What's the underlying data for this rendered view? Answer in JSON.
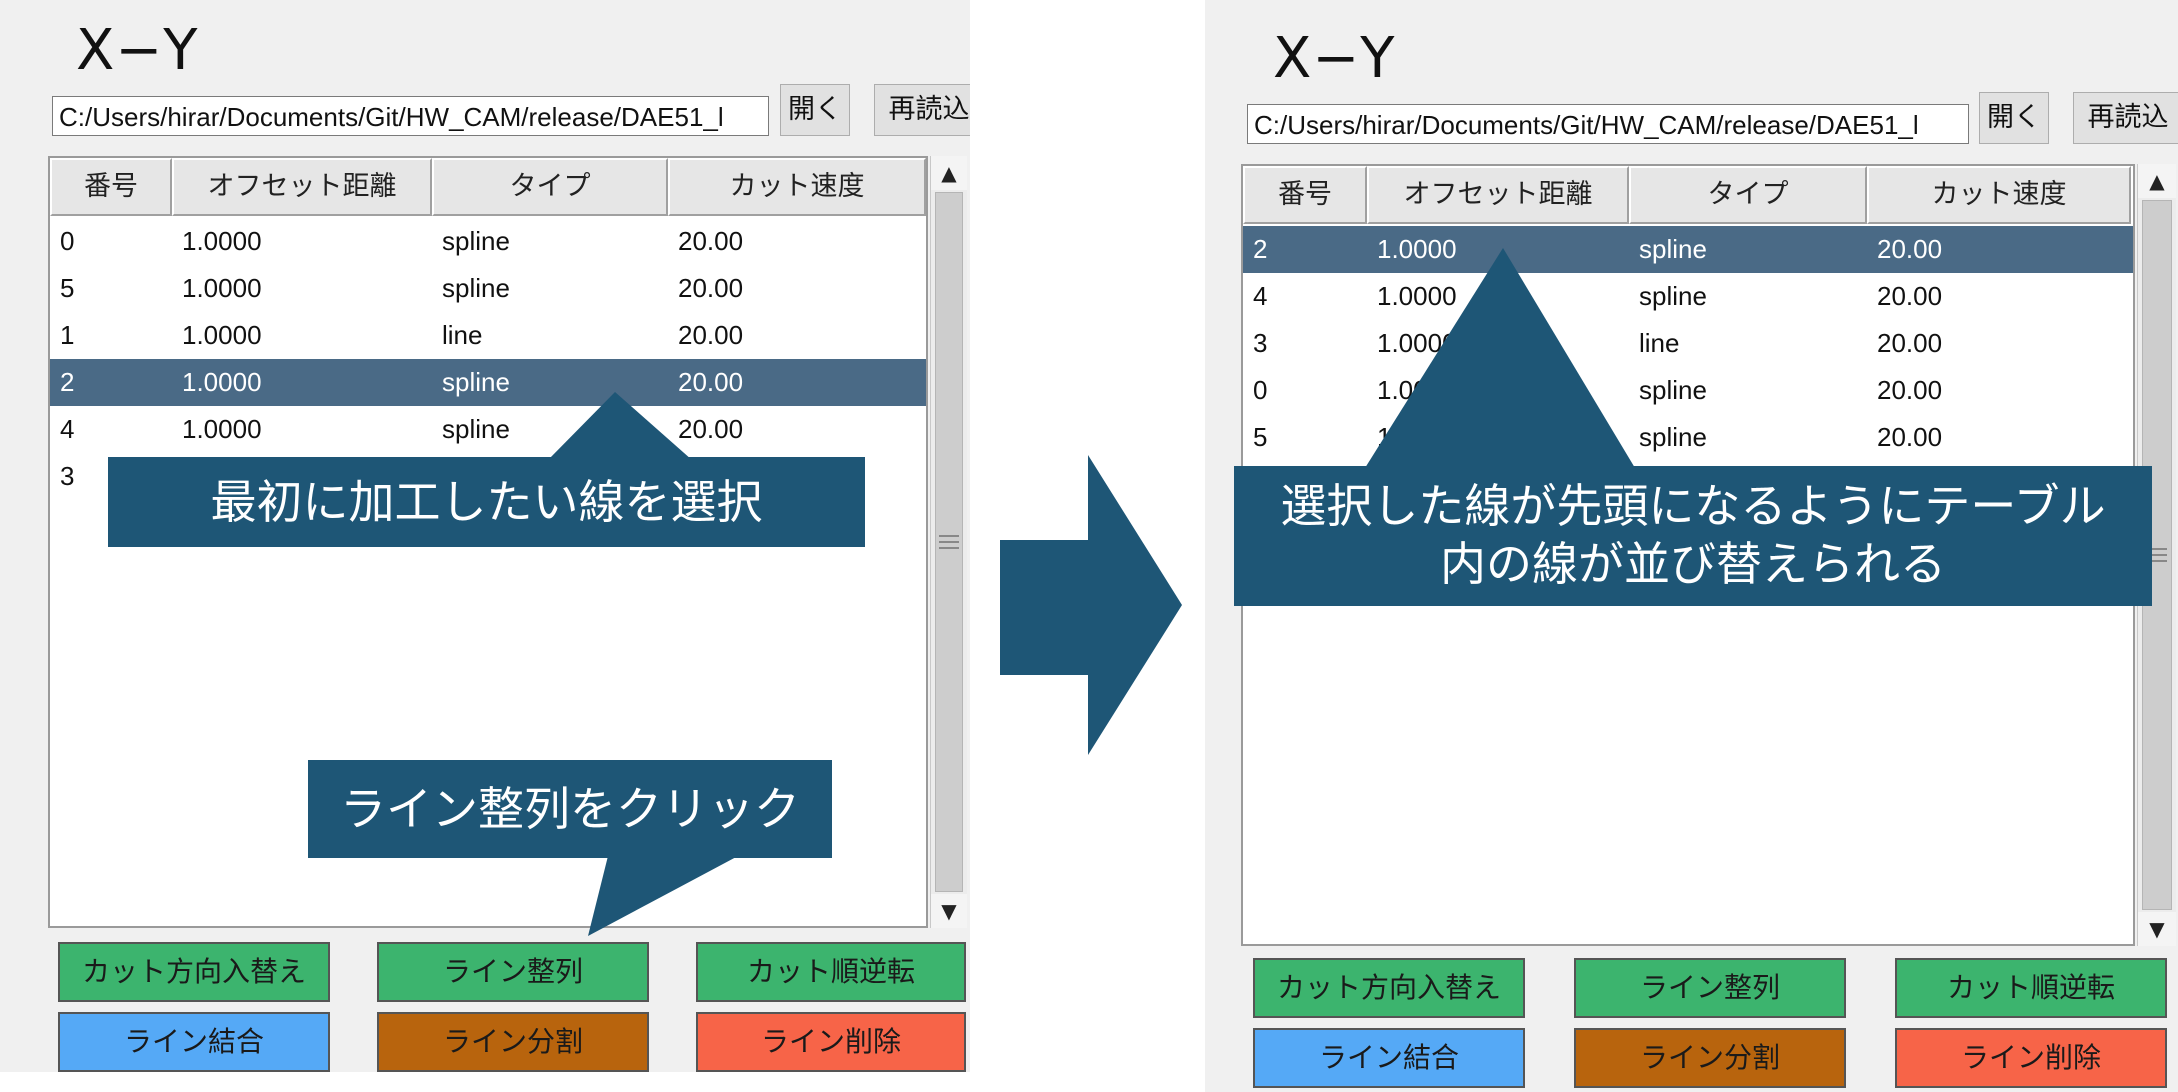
{
  "panels": {
    "left": {
      "title": "X−Y",
      "path": "C:/Users/hirar/Documents/Git/HW_CAM/release/DAE51_l",
      "open_label": "開く",
      "reload_label": "再読込",
      "columns": [
        "番号",
        "オフセット距離",
        "タイプ",
        "カット速度"
      ],
      "rows": [
        {
          "num": "0",
          "offset": "1.0000",
          "type": "spline",
          "speed": "20.00",
          "selected": false
        },
        {
          "num": "5",
          "offset": "1.0000",
          "type": "spline",
          "speed": "20.00",
          "selected": false
        },
        {
          "num": "1",
          "offset": "1.0000",
          "type": "line",
          "speed": "20.00",
          "selected": false
        },
        {
          "num": "2",
          "offset": "1.0000",
          "type": "spline",
          "speed": "20.00",
          "selected": true
        },
        {
          "num": "4",
          "offset": "1.0000",
          "type": "spline",
          "speed": "20.00",
          "selected": false
        },
        {
          "num": "3",
          "offset": "",
          "type": "",
          "speed": "",
          "selected": false
        }
      ],
      "buttons": [
        "カット方向入替え",
        "ライン整列",
        "カット順逆転",
        "ライン結合",
        "ライン分割",
        "ライン削除"
      ],
      "callouts": {
        "select_line": "最初に加工したい線を選択",
        "click_align": "ライン整列をクリック"
      }
    },
    "right": {
      "title": "X−Y",
      "path": "C:/Users/hirar/Documents/Git/HW_CAM/release/DAE51_l",
      "open_label": "開く",
      "reload_label": "再読込",
      "columns": [
        "番号",
        "オフセット距離",
        "タイプ",
        "カット速度"
      ],
      "rows": [
        {
          "num": "2",
          "offset": "1.0000",
          "type": "spline",
          "speed": "20.00",
          "selected": true
        },
        {
          "num": "4",
          "offset": "1.0000",
          "type": "spline",
          "speed": "20.00",
          "selected": false
        },
        {
          "num": "3",
          "offset": "1.0000",
          "type": "line",
          "speed": "20.00",
          "selected": false
        },
        {
          "num": "0",
          "offset": "1.00",
          "type": "spline",
          "speed": "20.00",
          "selected": false
        },
        {
          "num": "5",
          "offset": "1.",
          "type": "spline",
          "speed": "20.00",
          "selected": false
        }
      ],
      "buttons": [
        "カット方向入替え",
        "ライン整列",
        "カット順逆転",
        "ライン結合",
        "ライン分割",
        "ライン削除"
      ],
      "callouts": {
        "result_line1": "選択した線が先頭になるようにテーブル",
        "result_line2": "内の線が並び替えられる"
      }
    }
  },
  "colors": {
    "selected_row": "#4a6a86",
    "callout": "#1e5676",
    "btn_green": "#3cb46e",
    "btn_blue": "#55a9f6",
    "btn_brown": "#b8640d",
    "btn_red": "#f76448",
    "arrow": "#1e5676"
  },
  "icons": {
    "scroll_up": "triangle-up-icon",
    "scroll_down": "triangle-down-icon",
    "transition_arrow": "right-arrow-icon"
  }
}
